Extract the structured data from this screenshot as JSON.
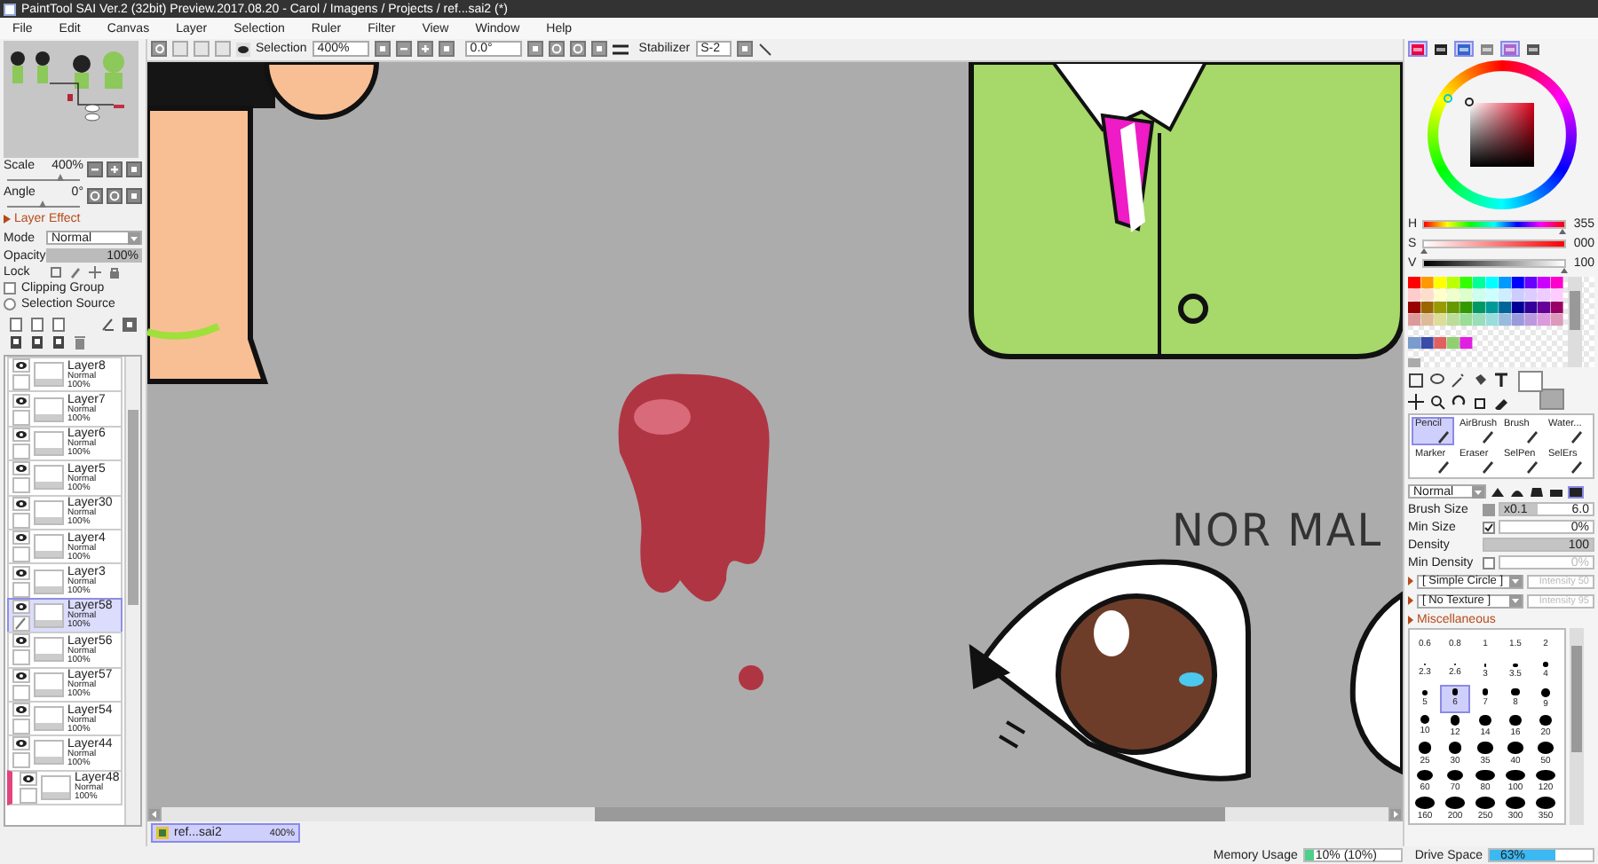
{
  "window": {
    "title": "PaintTool SAI Ver.2 (32bit) Preview.2017.08.20 - Carol / Imagens / Projects / ref...sai2 (*)"
  },
  "menu": [
    "File",
    "Edit",
    "Canvas",
    "Layer",
    "Selection",
    "Ruler",
    "Filter",
    "View",
    "Window",
    "Help"
  ],
  "toolbar": {
    "selection_label": "Selection",
    "zoom": "400%",
    "rotation": "0.0°",
    "stabilizer_label": "Stabilizer",
    "stabilizer": "S-2"
  },
  "navigator": {
    "scale": {
      "label": "Scale",
      "value": "400%",
      "level": 0.75
    },
    "angle": {
      "label": "Angle",
      "value": "0°",
      "level": 0.5
    }
  },
  "layer_effect": {
    "title": "Layer Effect",
    "expanded": false
  },
  "layer_props": {
    "mode_label": "Mode",
    "mode": "Normal",
    "opacity": {
      "label": "Opacity",
      "value": "100%",
      "level": 1
    },
    "lock_label": "Lock"
  },
  "options": [
    {
      "kind": "checkbox",
      "label": "Clipping Group",
      "checked": false
    },
    {
      "kind": "radio",
      "label": "Selection Source",
      "checked": false
    }
  ],
  "layers": [
    {
      "name": "Layer8",
      "mode": "Normal",
      "opacity": "100%",
      "visible": true,
      "selected": false,
      "clipped": false
    },
    {
      "name": "Layer7",
      "mode": "Normal",
      "opacity": "100%",
      "visible": true,
      "selected": false,
      "clipped": false
    },
    {
      "name": "Layer6",
      "mode": "Normal",
      "opacity": "100%",
      "visible": true,
      "selected": false,
      "clipped": false
    },
    {
      "name": "Layer5",
      "mode": "Normal",
      "opacity": "100%",
      "visible": true,
      "selected": false,
      "clipped": false
    },
    {
      "name": "Layer30",
      "mode": "Normal",
      "opacity": "100%",
      "visible": true,
      "selected": false,
      "clipped": false
    },
    {
      "name": "Layer4",
      "mode": "Normal",
      "opacity": "100%",
      "visible": true,
      "selected": false,
      "clipped": false
    },
    {
      "name": "Layer3",
      "mode": "Normal",
      "opacity": "100%",
      "visible": true,
      "selected": false,
      "clipped": false
    },
    {
      "name": "Layer58",
      "mode": "Normal",
      "opacity": "100%",
      "visible": true,
      "selected": true,
      "clipped": false
    },
    {
      "name": "Layer56",
      "mode": "Normal",
      "opacity": "100%",
      "visible": true,
      "selected": false,
      "clipped": false
    },
    {
      "name": "Layer57",
      "mode": "Normal",
      "opacity": "100%",
      "visible": true,
      "selected": false,
      "clipped": false
    },
    {
      "name": "Layer54",
      "mode": "Normal",
      "opacity": "100%",
      "visible": true,
      "selected": false,
      "clipped": false
    },
    {
      "name": "Layer44",
      "mode": "Normal",
      "opacity": "100%",
      "visible": true,
      "selected": false,
      "clipped": false
    },
    {
      "name": "Layer48",
      "mode": "Normal",
      "opacity": "100%",
      "visible": true,
      "selected": false,
      "clipped": true
    }
  ],
  "canvas": {
    "text": "NOR MAL"
  },
  "document_tabs": [
    {
      "name": "ref...sai2",
      "zoom": "400%",
      "selected": true
    }
  ],
  "color_panel_toggles": [
    {
      "on": true
    },
    {
      "on": false
    },
    {
      "on": true
    },
    {
      "on": false
    },
    {
      "on": true
    },
    {
      "on": false
    }
  ],
  "hsv": [
    {
      "label": "H",
      "value": "355",
      "level": 0.99
    },
    {
      "label": "S",
      "value": "000",
      "level": 0
    },
    {
      "label": "V",
      "value": "100",
      "level": 1
    }
  ],
  "brush_tools": [
    {
      "name": "Pencil",
      "selected": true
    },
    {
      "name": "AirBrush",
      "selected": false
    },
    {
      "name": "Brush",
      "selected": false
    },
    {
      "name": "Water...",
      "selected": false
    },
    {
      "name": "Marker",
      "selected": false
    },
    {
      "name": "Eraser",
      "selected": false
    },
    {
      "name": "SelPen",
      "selected": false
    },
    {
      "name": "SelErs",
      "selected": false
    }
  ],
  "brush": {
    "blend": "Normal",
    "tip_shapes": [
      {
        "selected": false
      },
      {
        "selected": false
      },
      {
        "selected": false
      },
      {
        "selected": false
      },
      {
        "selected": true
      }
    ],
    "size": {
      "label": "Brush Size",
      "multiplier": "x0.1",
      "value": "6.0",
      "level": 0.4
    },
    "min_size": {
      "label": "Min Size",
      "checked": true,
      "value": "0%",
      "level": 0
    },
    "density": {
      "label": "Density",
      "value": "100",
      "level": 1
    },
    "min_density": {
      "label": "Min Density",
      "checked": false,
      "value": "0%",
      "disabled": true
    },
    "shape": {
      "value": "[ Simple Circle ]",
      "intensity": "Intensity 50",
      "intensity_disabled": true
    },
    "texture": {
      "value": "[ No Texture ]",
      "intensity": "Intensity 95",
      "intensity_disabled": true
    },
    "misc": {
      "title": "Miscellaneous",
      "expanded": false
    }
  },
  "brush_sizes": [
    {
      "label": "0.6",
      "selected": false
    },
    {
      "label": "0.8",
      "selected": false
    },
    {
      "label": "1",
      "selected": false
    },
    {
      "label": "1.5",
      "selected": false
    },
    {
      "label": "2",
      "selected": false
    },
    {
      "label": "2.3",
      "selected": false
    },
    {
      "label": "2.6",
      "selected": false
    },
    {
      "label": "3",
      "selected": false
    },
    {
      "label": "3.5",
      "selected": false
    },
    {
      "label": "4",
      "selected": false
    },
    {
      "label": "5",
      "selected": false
    },
    {
      "label": "6",
      "selected": true
    },
    {
      "label": "7",
      "selected": false
    },
    {
      "label": "8",
      "selected": false
    },
    {
      "label": "9",
      "selected": false
    },
    {
      "label": "10",
      "selected": false
    },
    {
      "label": "12",
      "selected": false
    },
    {
      "label": "14",
      "selected": false
    },
    {
      "label": "16",
      "selected": false
    },
    {
      "label": "20",
      "selected": false
    },
    {
      "label": "25",
      "selected": false
    },
    {
      "label": "30",
      "selected": false
    },
    {
      "label": "35",
      "selected": false
    },
    {
      "label": "40",
      "selected": false
    },
    {
      "label": "50",
      "selected": false
    },
    {
      "label": "60",
      "selected": false
    },
    {
      "label": "70",
      "selected": false
    },
    {
      "label": "80",
      "selected": false
    },
    {
      "label": "100",
      "selected": false
    },
    {
      "label": "120",
      "selected": false
    },
    {
      "label": "160",
      "selected": false
    },
    {
      "label": "200",
      "selected": false
    },
    {
      "label": "250",
      "selected": false
    },
    {
      "label": "300",
      "selected": false
    },
    {
      "label": "350",
      "selected": false
    }
  ],
  "status": {
    "memory": {
      "label": "Memory Usage",
      "value": "10% (10%)",
      "level": 0.1
    },
    "drive": {
      "label": "Drive Space",
      "value": "63%",
      "level": 0.63
    }
  }
}
